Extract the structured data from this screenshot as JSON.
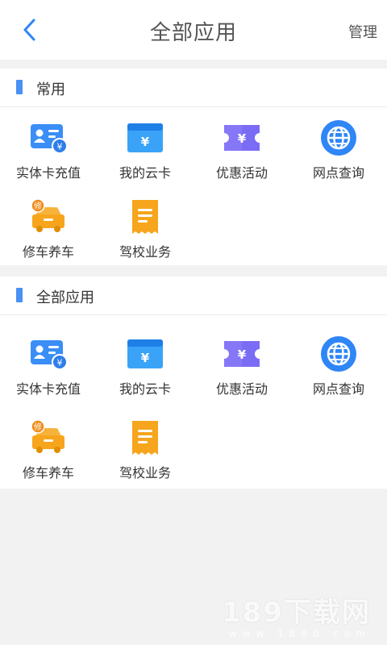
{
  "header": {
    "title": "全部应用",
    "manage_label": "管理"
  },
  "sections": [
    {
      "title": "常用",
      "apps": [
        {
          "label": "实体卡充值",
          "icon": "id-card-recharge-icon"
        },
        {
          "label": "我的云卡",
          "icon": "cloud-card-icon"
        },
        {
          "label": "优惠活动",
          "icon": "coupon-ticket-icon"
        },
        {
          "label": "网点查询",
          "icon": "globe-icon"
        },
        {
          "label": "修车养车",
          "icon": "car-repair-icon"
        },
        {
          "label": "驾校业务",
          "icon": "receipt-icon"
        }
      ]
    },
    {
      "title": "全部应用",
      "apps": [
        {
          "label": "实体卡充值",
          "icon": "id-card-recharge-icon"
        },
        {
          "label": "我的云卡",
          "icon": "cloud-card-icon"
        },
        {
          "label": "优惠活动",
          "icon": "coupon-ticket-icon"
        },
        {
          "label": "网点查询",
          "icon": "globe-icon"
        },
        {
          "label": "修车养车",
          "icon": "car-repair-icon"
        },
        {
          "label": "驾校业务",
          "icon": "receipt-icon"
        }
      ]
    }
  ],
  "icon_glyphs": {
    "yuan": "¥",
    "repair": "修"
  },
  "colors": {
    "accent": "#4a90f5",
    "purple": "#7b6cf6",
    "orange": "#f7a51c"
  },
  "watermark": {
    "main": "189下载网",
    "sub": "www.189d.com"
  }
}
